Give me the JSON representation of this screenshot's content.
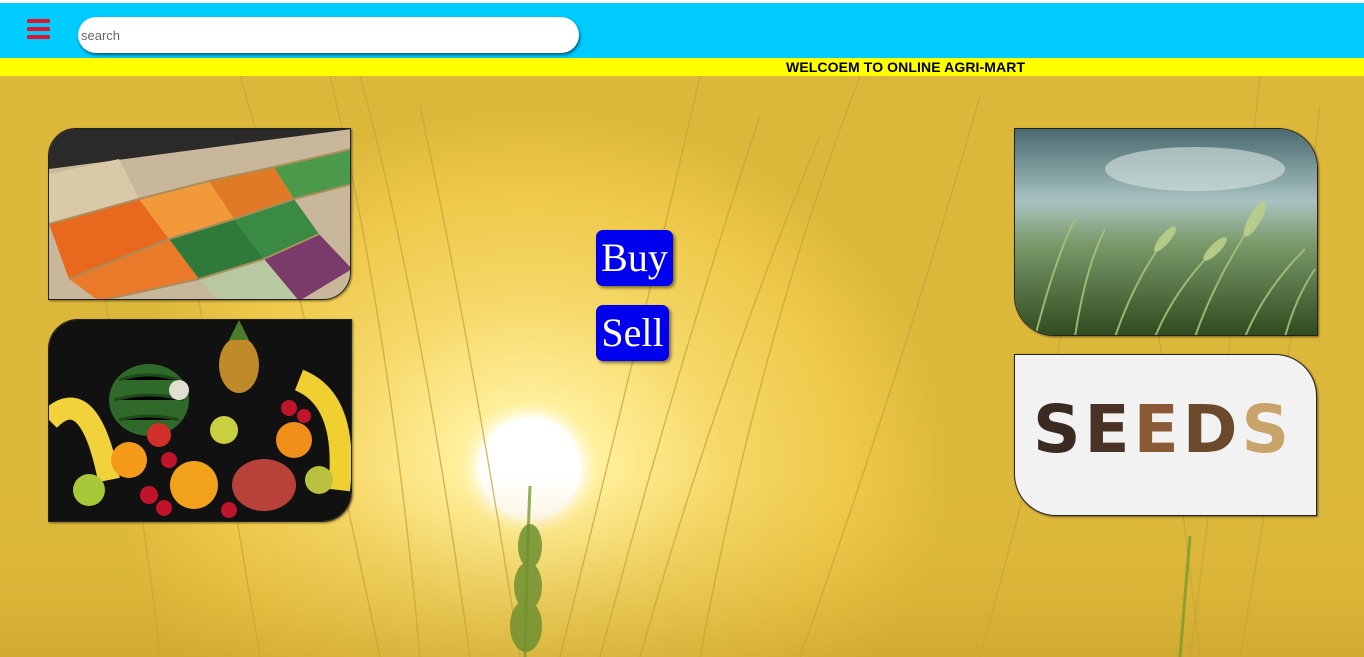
{
  "header": {
    "search_placeholder": "search"
  },
  "marquee": {
    "text": "WELCOEM TO ONLINE AGRI-MART"
  },
  "actions": {
    "buy_label": "Buy",
    "sell_label": "Sell"
  },
  "images": {
    "veg": "vegetable-market-crates",
    "fruit": "mixed-fruit-pile",
    "field": "wheat-field",
    "seeds": "seeds-lettering"
  },
  "seeds_lettering": "SEEDS",
  "colors": {
    "header_bg": "#00ccff",
    "marquee_bg": "#ffff00",
    "button_bg": "#0000ee",
    "menu_icon": "#e0142e"
  }
}
